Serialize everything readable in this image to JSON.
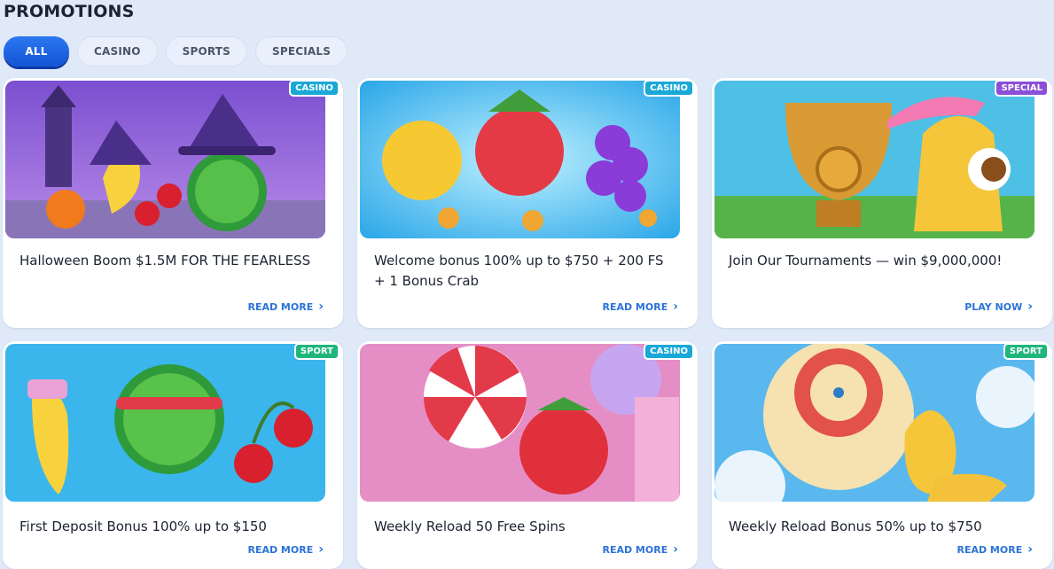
{
  "page_title": "PROMOTIONS",
  "tabs": [
    {
      "label": "ALL"
    },
    {
      "label": "CASINO"
    },
    {
      "label": "SPORTS"
    },
    {
      "label": "SPECIALS"
    }
  ],
  "colors": {
    "casino": "#1aa8d6",
    "special": "#8b4fd8",
    "sport": "#1fb67c",
    "cta": "#2b72d8",
    "active_tab": "#1f63e0"
  },
  "cards": [
    {
      "badge": "CASINO",
      "title": "Halloween Boom $1.5M FOR THE FEARLESS",
      "cta": "READ MORE",
      "image": "halloween-fruits"
    },
    {
      "badge": "CASINO",
      "title": "Welcome bonus 100% up to $750 + 200 FS + 1 Bonus Crab",
      "cta": "READ MORE",
      "image": "welcome-fruits"
    },
    {
      "badge": "SPECIAL",
      "title": "Join Our Tournaments — win $9,000,000!",
      "cta": "PLAY NOW",
      "image": "trophy-banana"
    },
    {
      "badge": "SPORT",
      "title": "First Deposit Bonus 100% up to $150",
      "cta": "READ MORE",
      "image": "sport-fruits"
    },
    {
      "badge": "CASINO",
      "title": "Weekly Reload 50 Free Spins",
      "cta": "READ MORE",
      "image": "candy-strawberry"
    },
    {
      "badge": "SPORT",
      "title": "Weekly Reload Bonus 50% up to $750",
      "cta": "READ MORE",
      "image": "parachute-banana"
    }
  ]
}
